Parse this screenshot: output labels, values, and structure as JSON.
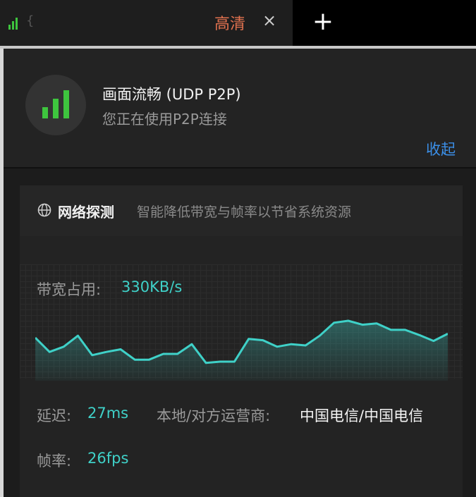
{
  "tab": {
    "loading_glyph": "{",
    "quality": "高清",
    "close_glyph": "×",
    "new_tab_glyph": "+"
  },
  "status": {
    "title": "画面流畅 (UDP P2P)",
    "subtitle": "您正在使用P2P连接",
    "collapse": "收起",
    "signal_color": "#3ec53e"
  },
  "detection": {
    "title": "网络探测",
    "description": "智能降低带宽与帧率以节省系统资源",
    "bandwidth_label": "带宽占用:",
    "bandwidth_value": "330KB/s",
    "latency_label": "延迟:",
    "latency_value": "27ms",
    "isp_label": "本地/对方运营商:",
    "isp_value": "中国电信/中国电信",
    "framerate_label": "帧率:",
    "framerate_value": "26fps",
    "accent_color": "#3fd1c8"
  },
  "chart_data": {
    "type": "area",
    "title": "",
    "xlabel": "",
    "ylabel": "",
    "grid": true,
    "ylim": [
      0,
      100
    ],
    "values": [
      62,
      40,
      48,
      65,
      35,
      40,
      44,
      28,
      28,
      37,
      37,
      52,
      23,
      25,
      25,
      60,
      58,
      48,
      52,
      50,
      65,
      85,
      88,
      82,
      84,
      74,
      74,
      66,
      57,
      68
    ]
  }
}
